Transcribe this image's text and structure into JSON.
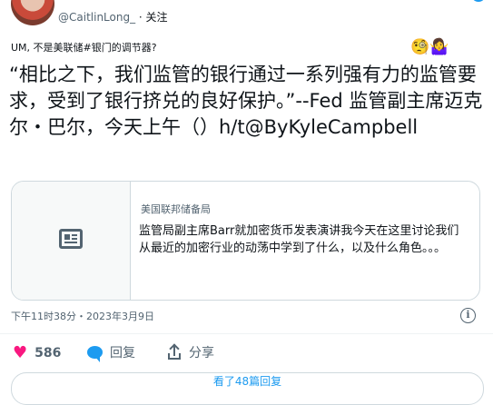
{
  "author": {
    "display_name": "",
    "handle": "@CaitlinLong_",
    "follow_label": "· 关注"
  },
  "tweet": {
    "small_line": "UM, 不是美联储#银门的调节器?",
    "emojis": "🧐🤷‍♀️",
    "quote_text": "“相比之下，我们监管的银行通过一系列强有力的监管要求，受到了银行挤兑的良好保护。”--Fed 监管副主席迈克尔・巴尔，今天上午（）h/t@ByKyleCampbell",
    "timestamp": "下午11时38分・2023年3月9日"
  },
  "card": {
    "source": "美国联邦储备局",
    "title": "监管局副主席Barr就加密货币发表演讲我今天在这里讨论我们从最近的加密行业的动荡中学到了什么，以及什么角色。。。"
  },
  "actions": {
    "likes_count": "586",
    "reply_label": "回复",
    "share_label": "分享"
  },
  "replies_button": "看了48篇回复",
  "colors": {
    "accent": "#1d9bf0",
    "like": "#f91880",
    "muted": "#536471",
    "border": "#cfd9de"
  },
  "icons": [
    "avatar",
    "bird-logo-icon",
    "newspaper-icon",
    "info-icon",
    "heart-icon",
    "comment-bubble-icon",
    "share-icon"
  ]
}
